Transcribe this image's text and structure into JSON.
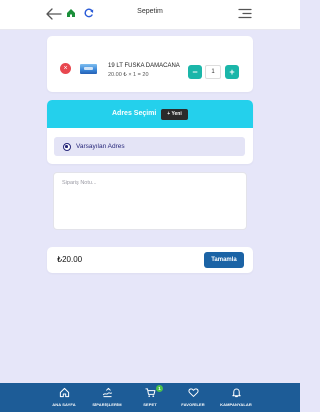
{
  "header": {
    "title": "Sepetim",
    "back_icon": "arrow-left-icon",
    "home_icon": "home-icon",
    "refresh_icon": "refresh-icon",
    "menu_icon": "menu-icon"
  },
  "cart": {
    "items": [
      {
        "name": "19 LT FUSKA DAMACANA",
        "price_line": "20.00 ₺ × 1 = 20",
        "quantity": "1",
        "minus_label": "−",
        "plus_label": "+",
        "remove_label": "×"
      }
    ]
  },
  "address": {
    "title": "Adres Seçimi",
    "new_button": "+ Yeni",
    "selected_option": "Varsayılan Adres"
  },
  "note": {
    "placeholder": "Sipariş Notu..."
  },
  "total": {
    "amount": "₺20.00",
    "complete_button": "Tamamla"
  },
  "bottom_nav": {
    "items": [
      {
        "label": "ANA SAYFA",
        "icon": "home-icon"
      },
      {
        "label": "SİPARİŞLERİM",
        "icon": "orders-icon"
      },
      {
        "label": "SEPET",
        "icon": "cart-icon",
        "badge": "1"
      },
      {
        "label": "FAVORİLER",
        "icon": "heart-icon"
      },
      {
        "label": "KAMPANYALAR",
        "icon": "bell-icon"
      }
    ]
  },
  "colors": {
    "background": "#e6e6f9",
    "accent_teal": "#1bb6a9",
    "address_header": "#24d0ec",
    "primary_blue": "#1b63a5",
    "nav_bar": "#1d5c97",
    "remove_red": "#e8474f",
    "badge_green": "#4cc24c"
  }
}
